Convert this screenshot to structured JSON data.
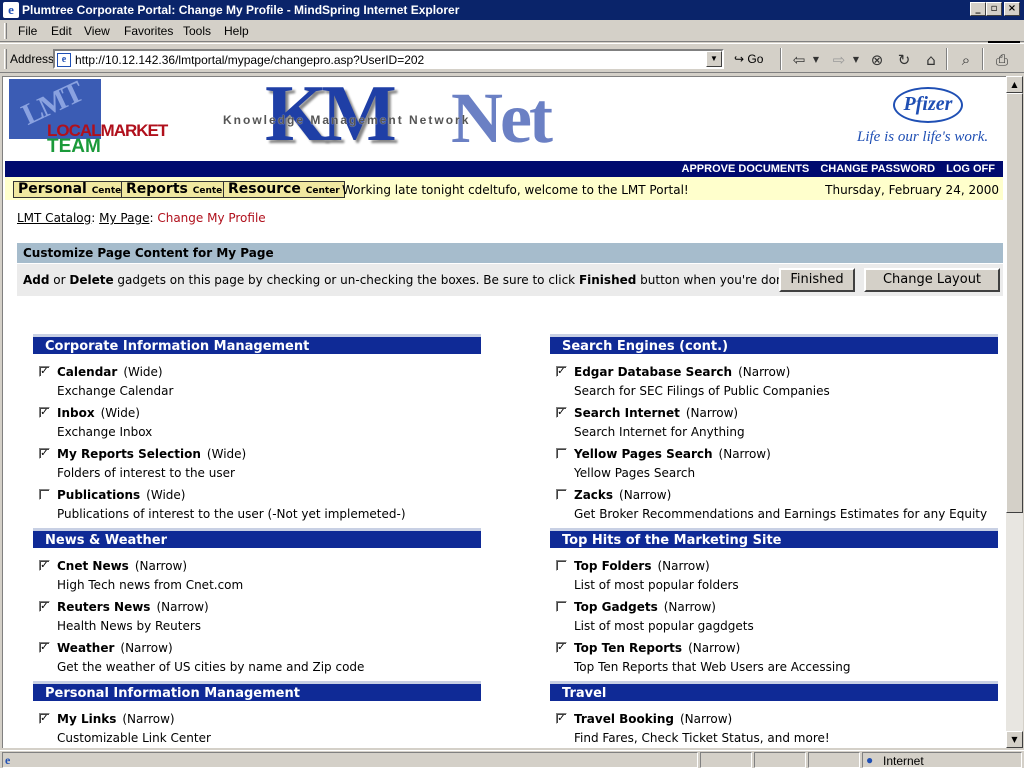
{
  "window": {
    "title": "Plumtree Corporate Portal: Change My Profile - MindSpring Internet Explorer",
    "buttons": {
      "minimize": "_",
      "maximize": "▫",
      "close": "×"
    }
  },
  "menu": [
    {
      "label": "File"
    },
    {
      "label": "Edit"
    },
    {
      "label": "View"
    },
    {
      "label": "Favorites"
    },
    {
      "label": "Tools"
    },
    {
      "label": "Help"
    }
  ],
  "address": {
    "label": "Address",
    "url": "http://10.12.142.36/lmtportal/mypage/changepro.asp?UserID=202",
    "go": "Go"
  },
  "status": {
    "zone": "Internet"
  },
  "header": {
    "lmt_logo": {
      "top": "LMT",
      "line1a": "LOCAL",
      "line1b": "MARKET",
      "line2": "TEAM"
    },
    "km_logo": {
      "big": "KM",
      "net": "Net",
      "sub": "Knowledge Management Network"
    },
    "pfizer": {
      "name": "Pfizer",
      "tagline": "Life is our life's work."
    },
    "nav_links": [
      "APPROVE DOCUMENTS",
      "CHANGE PASSWORD",
      "LOG OFF"
    ],
    "centers": [
      {
        "name": "Personal",
        "suffix": "Center"
      },
      {
        "name": "Reports",
        "suffix": "Center"
      },
      {
        "name": "Resource",
        "suffix": "Center"
      }
    ],
    "welcome": "Working late tonight cdeltufo, welcome to the LMT Portal!",
    "date": "Thursday, February 24, 2000"
  },
  "breadcrumb": {
    "items": [
      "LMT Catalog",
      "My Page"
    ],
    "current": "Change My Profile"
  },
  "customize": {
    "title": "Customize Page Content for My Page",
    "instructions": [
      {
        "t": "Add",
        "b": true
      },
      {
        "t": " or ",
        "b": false
      },
      {
        "t": "Delete",
        "b": true
      },
      {
        "t": " gadgets on this page by checking or un-checking the boxes. Be sure to click ",
        "b": false
      },
      {
        "t": "Finished",
        "b": true
      },
      {
        "t": " button when you're done.",
        "b": false
      }
    ],
    "finished_button": "Finished",
    "change_layout_button": "Change Layout"
  },
  "left_sections": [
    {
      "title": "Corporate Information Management",
      "items": [
        {
          "name": "Calendar",
          "type": "(Wide)",
          "desc": "Exchange Calendar",
          "checked": true
        },
        {
          "name": "Inbox",
          "type": "(Wide)",
          "desc": "Exchange Inbox",
          "checked": true
        },
        {
          "name": "My Reports Selection",
          "type": "(Wide)",
          "desc": "Folders of interest to the user",
          "checked": true
        },
        {
          "name": "Publications",
          "type": "(Wide)",
          "desc": "Publications of interest to the user (-Not yet implemeted-)",
          "checked": false
        }
      ]
    },
    {
      "title": "News & Weather",
      "items": [
        {
          "name": "Cnet News",
          "type": "(Narrow)",
          "desc": "High Tech news from Cnet.com",
          "checked": true
        },
        {
          "name": "Reuters News",
          "type": "(Narrow)",
          "desc": "Health News by Reuters",
          "checked": true
        },
        {
          "name": "Weather",
          "type": "(Narrow)",
          "desc": "Get the weather of US cities by name and Zip code",
          "checked": true
        }
      ]
    },
    {
      "title": "Personal Information Management",
      "items": [
        {
          "name": "My Links",
          "type": "(Narrow)",
          "desc": "Customizable Link Center",
          "checked": true
        }
      ]
    }
  ],
  "right_sections": [
    {
      "title": "Search Engines (cont.)",
      "items": [
        {
          "name": "Edgar Database Search",
          "type": "(Narrow)",
          "desc": "Search for SEC Filings of Public Companies",
          "checked": true
        },
        {
          "name": "Search Internet",
          "type": "(Narrow)",
          "desc": "Search Internet for Anything",
          "checked": true
        },
        {
          "name": "Yellow Pages Search",
          "type": "(Narrow)",
          "desc": "Yellow Pages Search",
          "checked": false
        },
        {
          "name": "Zacks",
          "type": "(Narrow)",
          "desc": "Get Broker Recommendations and Earnings Estimates for any Equity",
          "checked": false
        }
      ]
    },
    {
      "title": "Top Hits of the Marketing Site",
      "items": [
        {
          "name": "Top Folders",
          "type": "(Narrow)",
          "desc": "List of most popular folders",
          "checked": false
        },
        {
          "name": "Top Gadgets",
          "type": "(Narrow)",
          "desc": "List of most popular gagdgets",
          "checked": false
        },
        {
          "name": "Top Ten Reports",
          "type": "(Narrow)",
          "desc": "Top Ten Reports that Web Users are Accessing",
          "checked": true
        }
      ]
    },
    {
      "title": "Travel",
      "items": [
        {
          "name": "Travel Booking",
          "type": "(Narrow)",
          "desc": "Find Fares, Check Ticket Status, and more!",
          "checked": true
        }
      ]
    }
  ]
}
